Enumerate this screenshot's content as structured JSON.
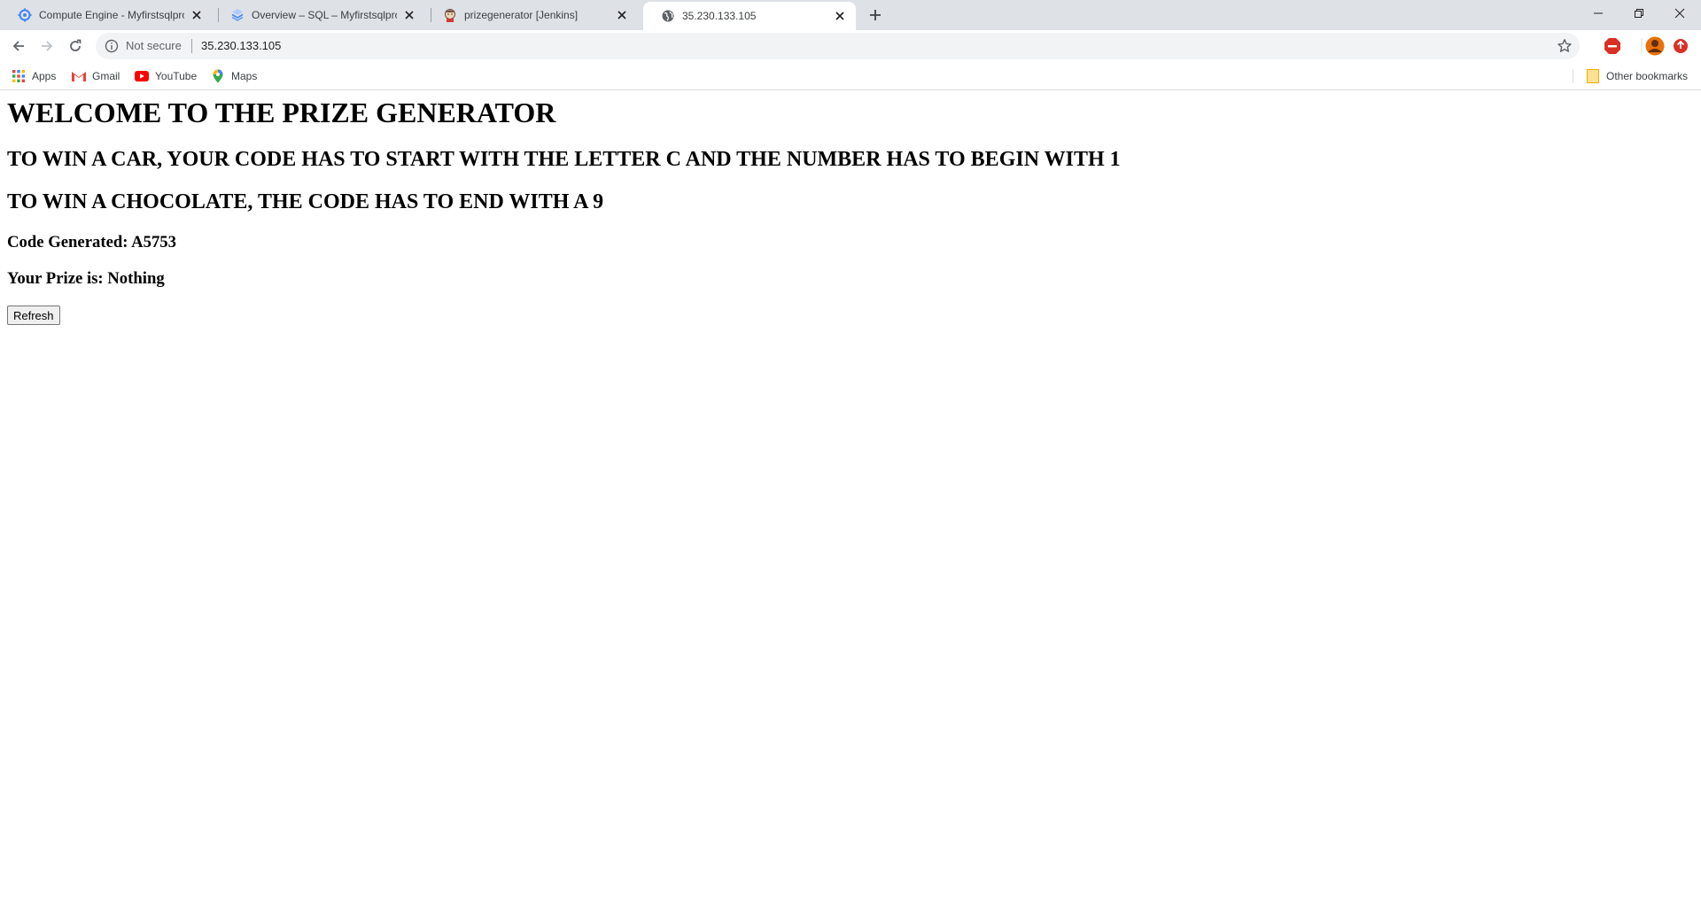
{
  "browser": {
    "tabs": [
      {
        "title": "Compute Engine - Myfirstsqlproj",
        "icon": "compute-engine-icon",
        "active": false
      },
      {
        "title": "Overview – SQL – Myfirstsqlproje",
        "icon": "cloud-sql-icon",
        "active": false
      },
      {
        "title": "prizegenerator [Jenkins]",
        "icon": "jenkins-icon",
        "active": false
      },
      {
        "title": "35.230.133.105",
        "icon": "globe-icon",
        "active": true
      }
    ],
    "address_bar": {
      "security_label": "Not secure",
      "url": "35.230.133.105"
    },
    "bookmarks": [
      {
        "label": "Apps",
        "icon": "apps-grid-icon"
      },
      {
        "label": "Gmail",
        "icon": "gmail-icon"
      },
      {
        "label": "YouTube",
        "icon": "youtube-icon"
      },
      {
        "label": "Maps",
        "icon": "maps-pin-icon"
      }
    ],
    "other_bookmarks": "Other bookmarks"
  },
  "page": {
    "heading": "WELCOME TO THE PRIZE GENERATOR",
    "rule_car": "TO WIN A CAR, YOUR CODE HAS TO START WITH THE LETTER C AND THE NUMBER HAS TO BEGIN WITH 1",
    "rule_chocolate": "TO WIN A CHOCOLATE, THE CODE HAS TO END WITH A 9",
    "code_line": "Code Generated: A5753",
    "prize_line": "Your Prize is: Nothing",
    "refresh_label": "Refresh"
  }
}
